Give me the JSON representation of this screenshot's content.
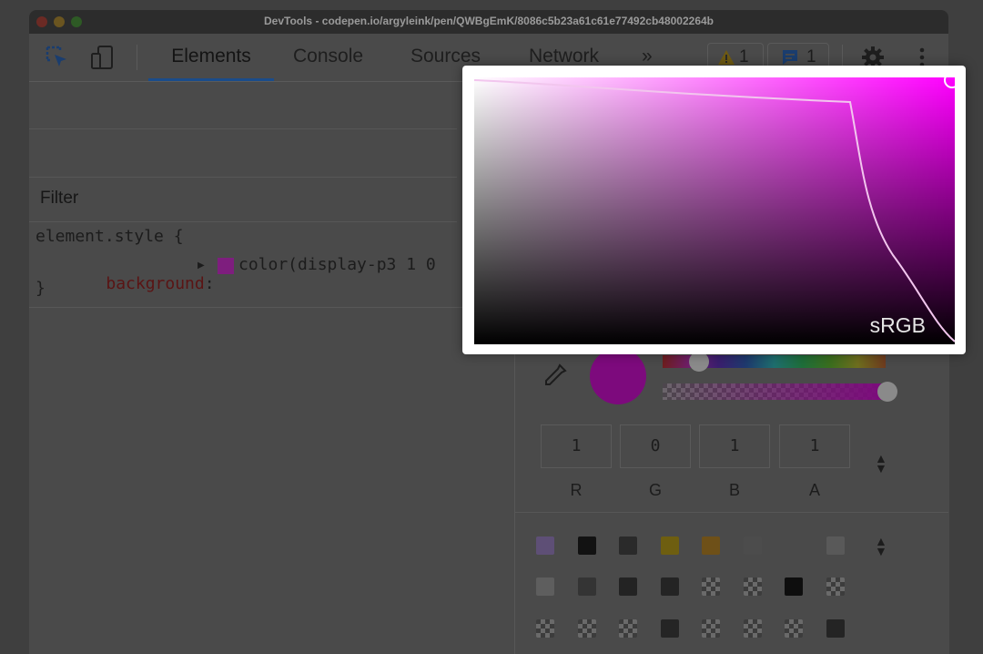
{
  "window": {
    "title": "DevTools - codepen.io/argyleink/pen/QWBgEmK/8086c5b23a61c61e77492cb48002264b"
  },
  "toolbar": {
    "tabs": [
      {
        "label": "Elements",
        "active": true
      },
      {
        "label": "Console",
        "active": false
      },
      {
        "label": "Sources",
        "active": false
      },
      {
        "label": "Network",
        "active": false
      }
    ],
    "more": "»",
    "warnings_count": "1",
    "messages_count": "1"
  },
  "styles": {
    "filter_label": "Filter",
    "selector": "element.style {",
    "property": "background",
    "colon": ":",
    "value": "color(display-p3 1 0",
    "semicolon": ";",
    "close": "}"
  },
  "picker": {
    "gamut_label": "sRGB",
    "color": "#ff00ff",
    "alpha_percent": 100,
    "channels": [
      {
        "label": "R",
        "value": "1"
      },
      {
        "label": "G",
        "value": "0"
      },
      {
        "label": "B",
        "value": "1"
      },
      {
        "label": "A",
        "value": "1"
      }
    ]
  },
  "palette": [
    [
      "#5e4f76",
      "#121212",
      "#2a2a2a",
      "#6e5e10",
      "#6e5018",
      "#4c4c4c",
      "#4a4a4a",
      "#595959"
    ],
    [
      "#5e5e5e",
      "#343434",
      "#232323",
      "#242424",
      "checker",
      "checker",
      "#0e0e0e",
      "checker"
    ],
    [
      "checker",
      "checker",
      "checker",
      "#252525",
      "checker",
      "checker",
      "checker",
      "#242424"
    ]
  ]
}
